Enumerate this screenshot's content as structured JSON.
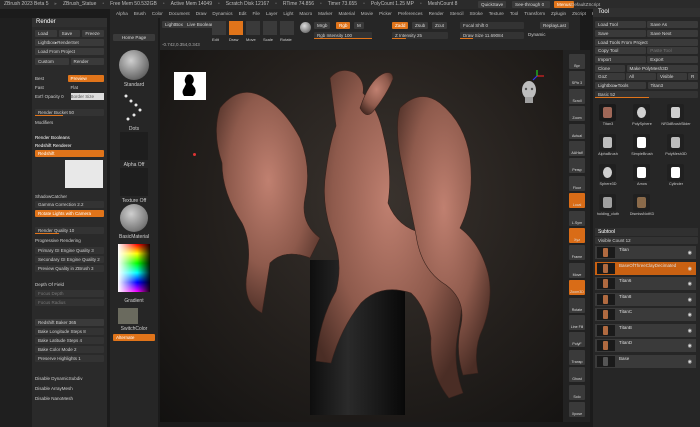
{
  "window": {
    "title": "ZBrush 2023 Beta 5",
    "doc": "ZBrush_Statue",
    "stats": [
      "Free Mem 50.532GB",
      "Active Mem 14049",
      "Scratch Disk 12167",
      "RTime 74.856",
      "Timer 73.655",
      "PolyCount 1.25 MP",
      "MeshCount 8"
    ],
    "quicksave": "QuickSave",
    "see_through": "See-through",
    "see_through_val": "0",
    "menus_label": "Menus",
    "default_script": "DefaultZScript"
  },
  "menubar": [
    "Alpha",
    "Brush",
    "Color",
    "Document",
    "Draw",
    "Dynamics",
    "Edit",
    "File",
    "Layer",
    "Light",
    "Macro",
    "Marker",
    "Material",
    "Movie",
    "Picker",
    "Preferences",
    "Render",
    "Stencil",
    "Stroke",
    "Texture",
    "Tool",
    "Transform",
    "Zplugin",
    "Zscript",
    "Help"
  ],
  "render_panel": {
    "title": "Render",
    "buttons_row1": [
      "Load",
      "Save",
      "Freeze"
    ],
    "lightbox_render": "Lightbox▸RenderSet",
    "load_from_project": "Load From Project",
    "custom": "Custom",
    "render": "Render",
    "best": "Best",
    "preview": "Preview",
    "fast": "Fast",
    "flat": "Flat",
    "external_opacity": "Ext'l Opacity 0",
    "border_size": "Border Size",
    "render_bucket": "Render Bucket 50",
    "modifiers": "Modifiers",
    "booleans_header": "Render Booleans",
    "redshift_renderer": "Redshift Renderer",
    "redshift": "Redshift",
    "shadow_catcher": "ShadowCatcher",
    "gamma_correction": "Gamma Correction 2.2",
    "rotate_lights": "Rotate Lights with Camera",
    "render_quality": "Render Quality 10",
    "progressive": "Progressive Rendering",
    "primary_gi": "Primary GI Engine Quality 3",
    "secondary_gi": "Secondary GI Engine Quality 2",
    "preview_quality": "Preview Quality in ZBrush 3",
    "depth_of_field": "Depth Of Field",
    "focus_depth": "Focus Depth",
    "focus_radius": "Focus Radius",
    "redshift_baker": "Redshift Baker 365",
    "bake_longitude": "Bake Longitude Steps 8",
    "bake_latitude": "Bake Latitude Steps 4",
    "bake_color": "Bake Color Mode 2",
    "preserve_highlights": "Preserve Highlights 1",
    "disable_dynamic": "Disable DynamicSubdiv",
    "disable_array": "Disable ArrayMesh",
    "disable_nano": "Disable NanoMesh"
  },
  "shelf": {
    "home_page": "Home Page",
    "lightbox": "LightBox",
    "live_boolean": "Live Boolean",
    "standard": "Standard",
    "dots": "Dots",
    "alpha_off": "Alpha Off",
    "texture_off": "Texture Off",
    "material": "BasicMaterial",
    "gradient": "Gradient",
    "switch_color": "SwitchColor",
    "alternate": "Alternate"
  },
  "topbar": {
    "edit": "Edit",
    "draw": "Draw",
    "move": "Move",
    "scale": "Scale",
    "rotate": "Rotate",
    "mrgb": "Mrgb",
    "rgb": "Rgb",
    "m": "M",
    "zadd": "Zadd",
    "zsub": "Zsub",
    "zcut": "Zcut",
    "rgb_intensity": "Rgb Intensity 100",
    "z_intensity": "Z Intensity 25",
    "focal_shift": "Focal Shift 0",
    "draw_size": "Draw Size 11.69084",
    "dynamic": "Dynamic",
    "replay_last": "ReplayLast",
    "coords": "-0.742,0.354,0.343"
  },
  "tool_panel": {
    "title": "Tool",
    "load_tool": "Load Tool",
    "save_as": "Save As",
    "save": "Save",
    "save_next": "Save Next",
    "load_tools_from_project": "Load Tools From Project",
    "copy_tool": "Copy Tool",
    "paste_tool": "Paste Tool",
    "import": "Import",
    "export": "Export",
    "clone": "Clone",
    "make_polymesh": "Make PolyMesh3D",
    "goz": "GoZ",
    "all": "All",
    "visible": "Visible",
    "r": "R",
    "lightbox_tools": "Lightbox▸Tools",
    "tool_name": "Titan3",
    "scale_label": "Basic 52",
    "tools": [
      "Titan3",
      "PolySphere",
      "NR3dBrushSlider",
      "AlphaBrush",
      "SimpleBrush",
      "PolyMesh3D",
      "Sphere3D",
      "Arrow",
      "Cylinder",
      "holding_cloth",
      "DismissNotKD"
    ],
    "subtool_header": "Subtool",
    "visible_count": "Visible Count 12",
    "subtools": [
      "Titan",
      "BaseOfThreeClayDecimated",
      "Titan6",
      "Titan8",
      "TitanC",
      "TitanB",
      "TitanD",
      "Base"
    ]
  },
  "right_shelf": [
    "Bpr",
    "SPix 3",
    "Scroll",
    "Zoom",
    "Actual",
    "AAHalf",
    "Persp",
    "Floor",
    "Local",
    "L.Sym",
    "Xyz",
    "Frame",
    "Move",
    "Zoom3D",
    "Rotate",
    "Line Fill",
    "PolyF",
    "Transp",
    "Ghost",
    "Solo",
    "Xpose"
  ],
  "colors": {
    "accent": "#e0741a",
    "statue": "#a06858",
    "panel": "#2a2a2a"
  }
}
